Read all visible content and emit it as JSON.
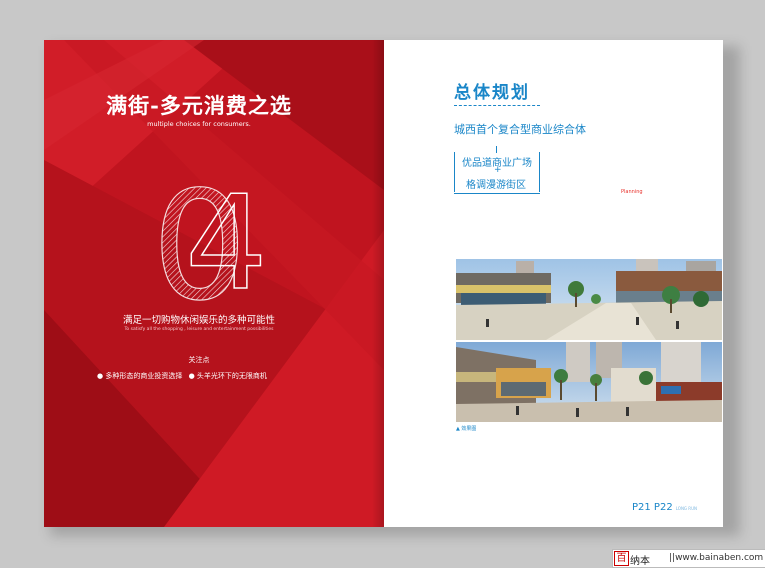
{
  "left_page": {
    "title": "满街-多元消费之选",
    "subtitle": "multiple choices for consumers.",
    "big_number": "04",
    "slogan": "满足一切购物休闲娱乐的多种可能性",
    "slogan_en": "To satisfy all the shopping , leisure and entertainment possibilities",
    "focus_label": "关注点",
    "bullets": [
      "● 多种形态的商业投资选择",
      "● 头羊光环下的无限商机"
    ]
  },
  "right_page": {
    "heading": "总体规划",
    "subheading": "城西首个复合型商业综合体",
    "box_line1": "优品道商业广场",
    "box_plus": "+",
    "box_line2": "格调漫游街区",
    "planning_label": "Planning",
    "photo_caption": "▲ 效果图",
    "page_numbers": "P21 P22",
    "page_numbers_tag": "LONG RUN"
  },
  "watermark": {
    "logo": "百",
    "name": "纳本",
    "url": "||www.bainaben.com"
  },
  "colors": {
    "red": "#c0141f",
    "blue": "#1a86c8",
    "background": "#c8c8c8"
  }
}
